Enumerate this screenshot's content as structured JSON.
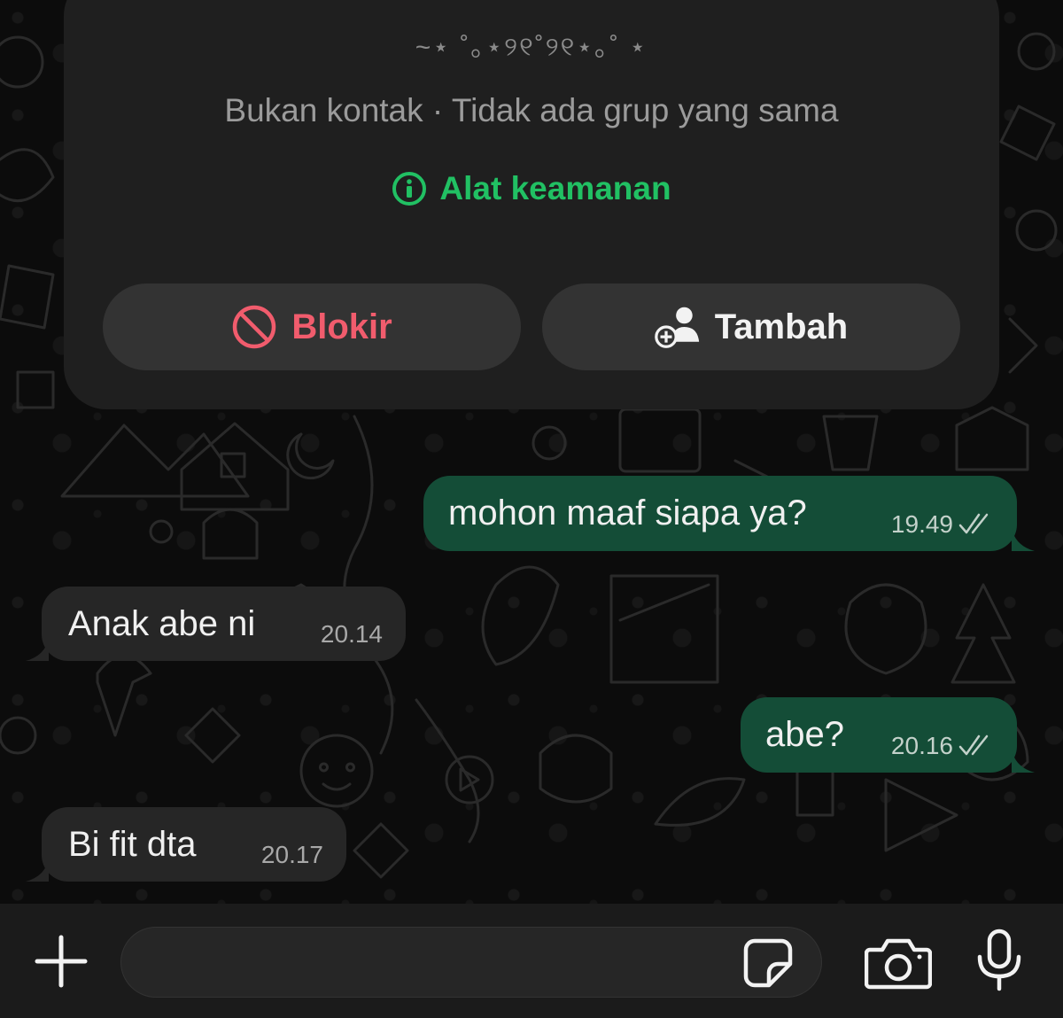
{
  "contact": {
    "name": "~⋆ ˚｡⋆୨୧˚୨୧⋆｡˚ ⋆",
    "subtitle": "Bukan kontak · Tidak ada grup yang sama",
    "security_link": "Alat keamanan",
    "block_label": "Blokir",
    "add_label": "Tambah"
  },
  "messages": [
    {
      "direction": "out",
      "text": "mohon maaf siapa ya?",
      "time": "19.49"
    },
    {
      "direction": "in",
      "text": "Anak abe ni",
      "time": "20.14"
    },
    {
      "direction": "out",
      "text": "abe?",
      "time": "20.16"
    },
    {
      "direction": "in",
      "text": "Bi fit dta",
      "time": "20.17"
    }
  ],
  "composer": {
    "value": "",
    "icons": [
      "plus-icon",
      "sticker-icon",
      "camera-icon",
      "microphone-icon"
    ]
  },
  "colors": {
    "accent_green": "#21c063",
    "danger_red": "#f15c6d",
    "outgoing_bubble": "#144d37",
    "incoming_bubble": "#262626"
  }
}
